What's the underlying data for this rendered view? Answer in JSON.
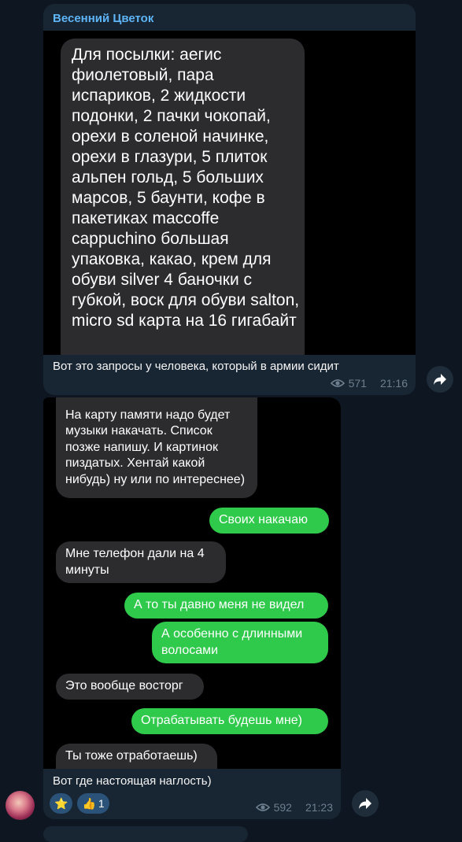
{
  "post1": {
    "author": "Весенний Цветок",
    "note_text": "Для посылки: аегис фиолетовый, пара испариков, 2 жидкости подонки, 2 пачки чокопай, орехи в соленой начинке, орехи в глазури, 5 плиток альпен гольд, 5 больших марсов, 5 баунти, кофе в пакетиках maccoffe cappuchino большая упаковка, какао, крем для обуви silver 4 баночки с губкой, воск для обуви salton, micro sd карта на 16 гигабайт",
    "caption": "Вот это запросы у человека, который в армии сидит",
    "views": "571",
    "time": "21:16"
  },
  "post2": {
    "messages": [
      {
        "dir": "in",
        "text": "На карту памяти надо будет музыки накачать. Список позже напишу. И картинок пиздатых. Хентай какой нибудь) ну или по интереснее)"
      },
      {
        "dir": "out",
        "text": "Своих накачаю"
      },
      {
        "dir": "in",
        "text": "Мне телефон дали на 4 минуты"
      },
      {
        "dir": "out",
        "text": "А то ты давно меня не видел"
      },
      {
        "dir": "out",
        "text": "А особенно с длинными волосами"
      },
      {
        "dir": "in",
        "text": "Это вообще восторг"
      },
      {
        "dir": "out",
        "text": "Отрабатывать будешь мне)"
      },
      {
        "dir": "in",
        "text": "Ты тоже отработаешь)"
      }
    ],
    "caption": "Вот где настоящая наглость)",
    "reactions": [
      {
        "emoji": "⭐",
        "icon": "star-icon",
        "count": ""
      },
      {
        "emoji": "👍",
        "icon": "thumbs-up-icon",
        "count": "1"
      }
    ],
    "views": "592",
    "time": "21:23"
  },
  "colors": {
    "background": "#0e1621",
    "bubble": "#182533",
    "author": "#5eb5f7",
    "outgoing": "#2fc94b",
    "incoming": "#2c2c2e",
    "meta": "#6d7f8f"
  }
}
